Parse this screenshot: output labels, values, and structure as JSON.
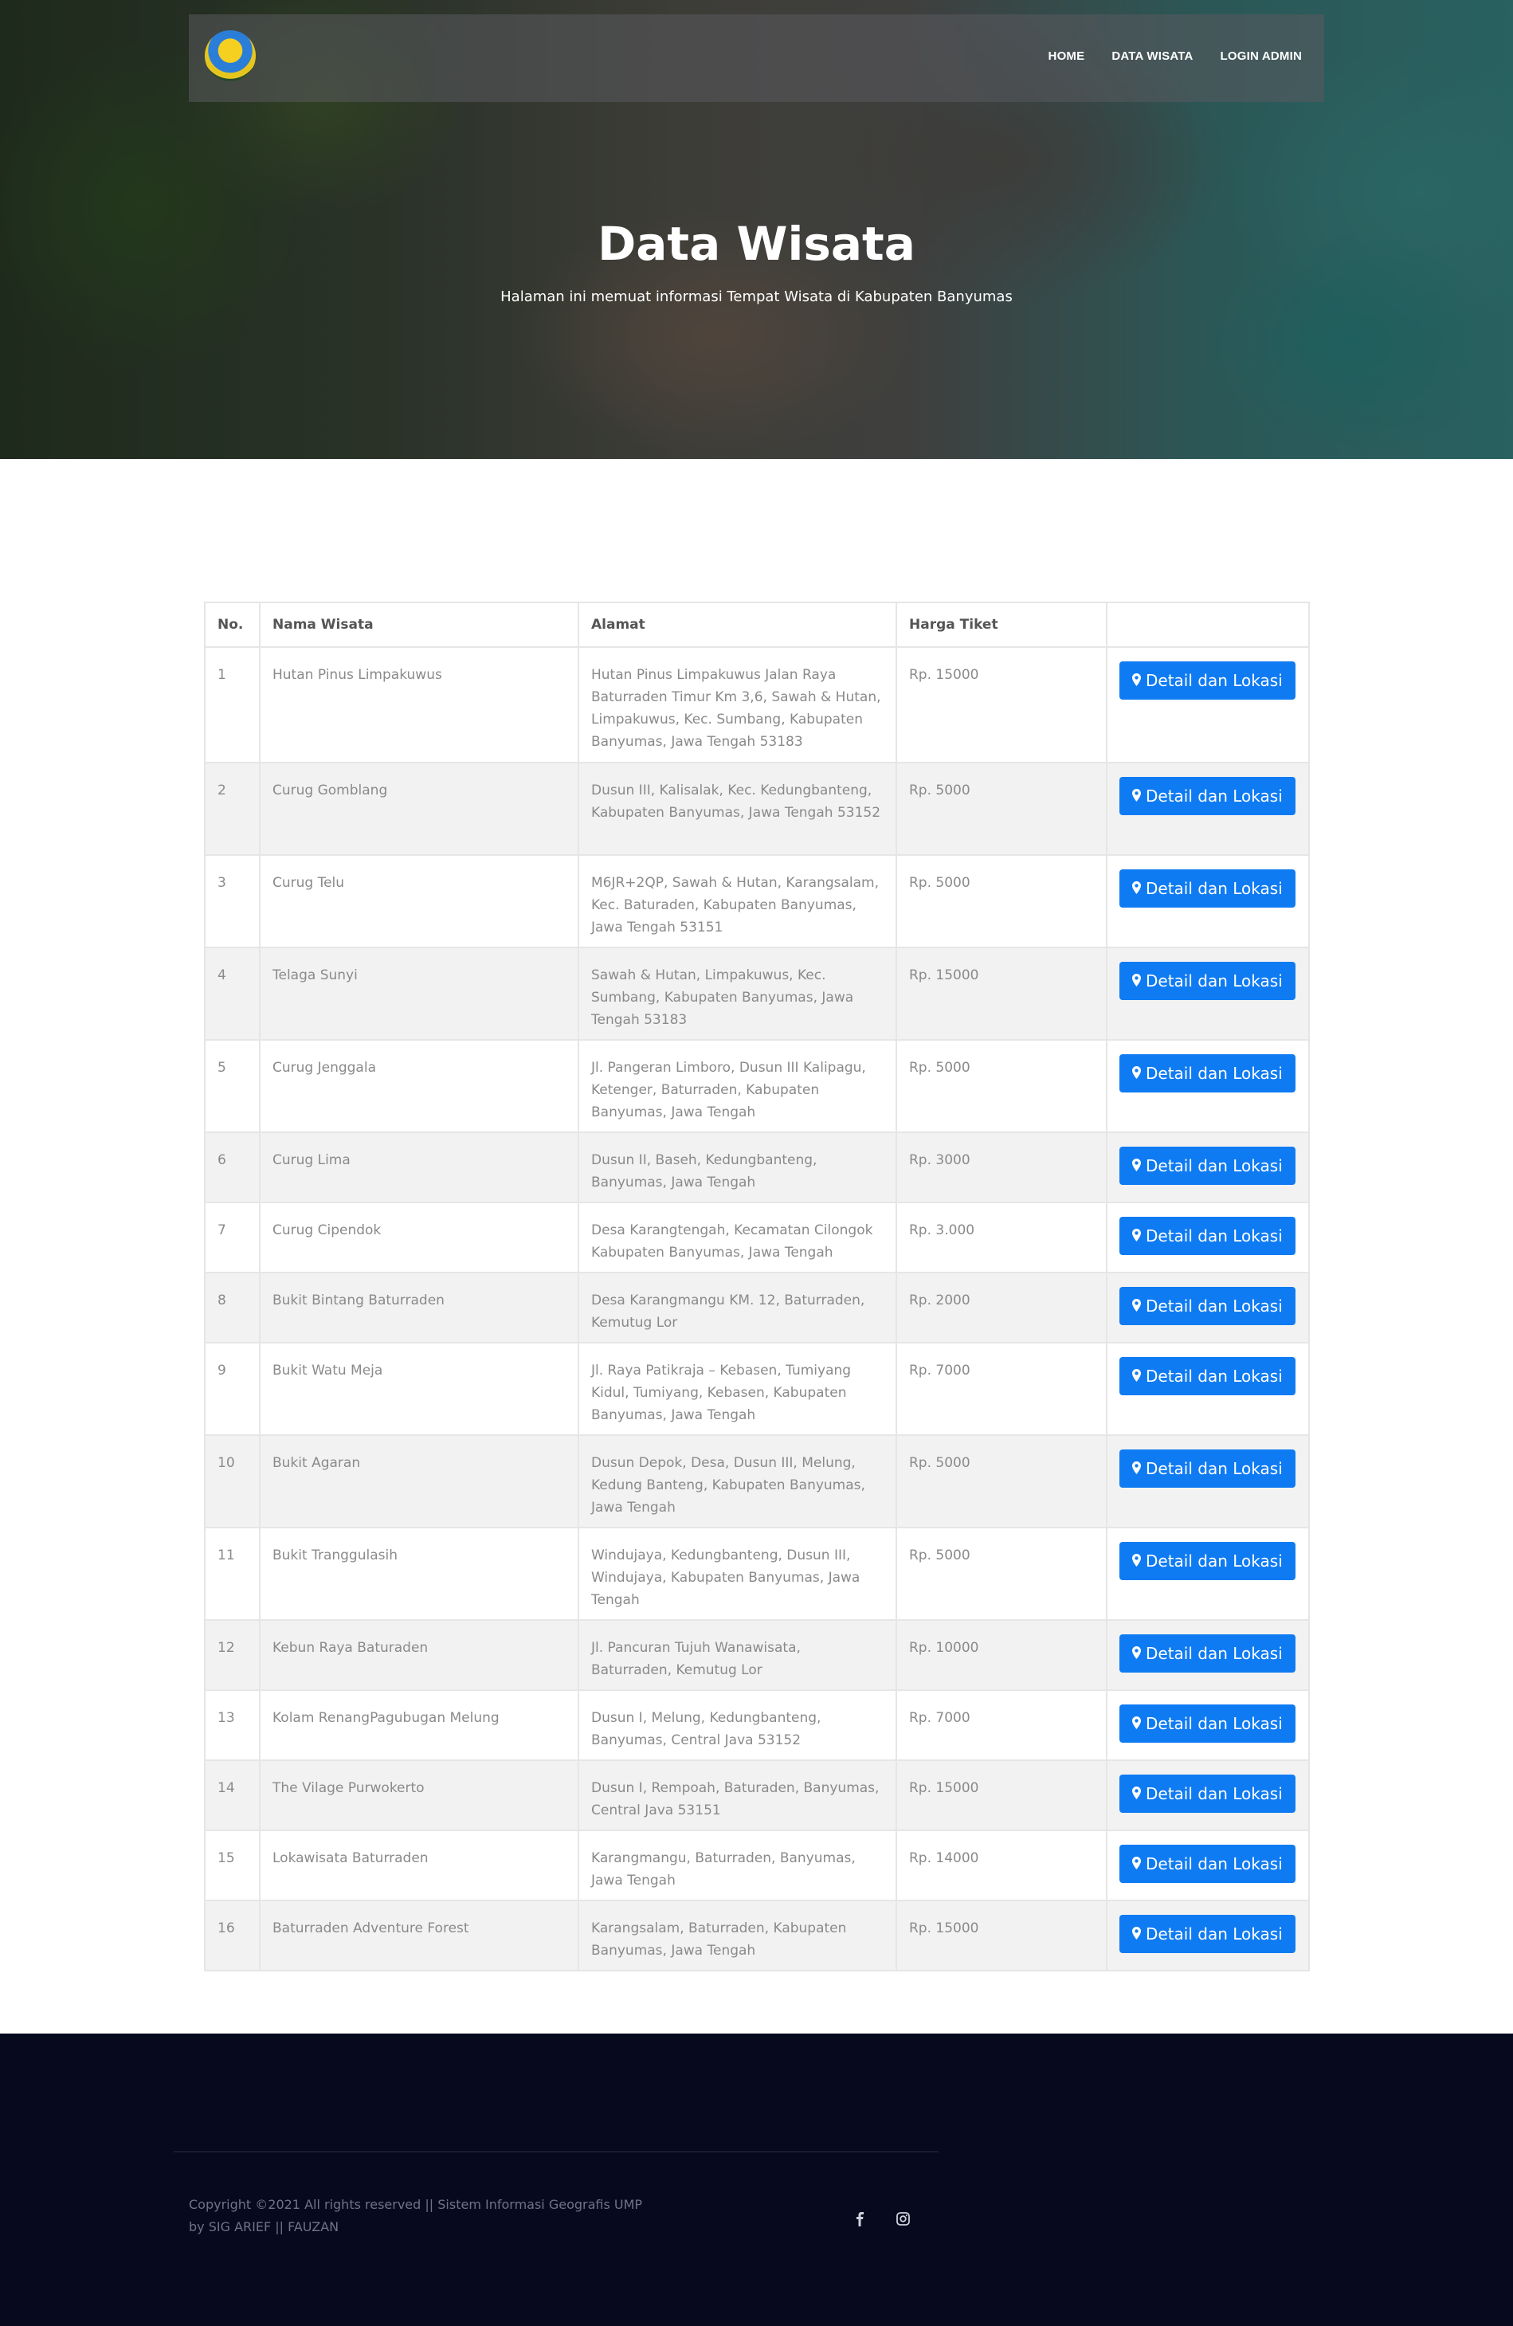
{
  "nav": {
    "links": [
      "HOME",
      "DATA WISATA",
      "LOGIN ADMIN"
    ]
  },
  "hero": {
    "title": "Data Wisata",
    "subtitle": "Halaman ini memuat informasi Tempat Wisata di Kabupaten Banyumas"
  },
  "table": {
    "headers": [
      "No.",
      "Nama Wisata",
      "Alamat",
      "Harga Tiket",
      ""
    ],
    "button_label": "Detail dan Lokasi",
    "rows": [
      {
        "no": "1",
        "nama": "Hutan Pinus Limpakuwus",
        "alamat": "Hutan Pinus Limpakuwus Jalan Raya Baturraden Timur Km 3,6, Sawah & Hutan, Limpakuwus, Kec. Sumbang, Kabupaten Banyumas, Jawa Tengah 53183",
        "harga": "Rp. 15000"
      },
      {
        "no": "2",
        "nama": "Curug Gomblang",
        "alamat": "Dusun III, Kalisalak, Kec. Kedungbanteng, Kabupaten Banyumas, Jawa Tengah 53152",
        "harga": "Rp. 5000"
      },
      {
        "no": "3",
        "nama": "Curug Telu",
        "alamat": "M6JR+2QP, Sawah & Hutan, Karangsalam, Kec. Baturaden, Kabupaten Banyumas, Jawa Tengah 53151",
        "harga": "Rp. 5000"
      },
      {
        "no": "4",
        "nama": "Telaga Sunyi",
        "alamat": "Sawah & Hutan, Limpakuwus, Kec. Sumbang, Kabupaten Banyumas, Jawa Tengah 53183",
        "harga": "Rp. 15000"
      },
      {
        "no": "5",
        "nama": "Curug Jenggala",
        "alamat": "Jl. Pangeran Limboro, Dusun III Kalipagu, Ketenger, Baturraden, Kabupaten Banyumas, Jawa Tengah",
        "harga": "Rp. 5000"
      },
      {
        "no": "6",
        "nama": "Curug Lima",
        "alamat": "Dusun II, Baseh, Kedungbanteng, Banyumas, Jawa Tengah",
        "harga": "Rp. 3000"
      },
      {
        "no": "7",
        "nama": "Curug Cipendok",
        "alamat": "Desa Karangtengah, Kecamatan Cilongok Kabupaten Banyumas, Jawa Tengah",
        "harga": "Rp. 3.000"
      },
      {
        "no": "8",
        "nama": "Bukit Bintang Baturraden",
        "alamat": "Desa Karangmangu KM. 12, Baturraden, Kemutug Lor",
        "harga": "Rp. 2000"
      },
      {
        "no": "9",
        "nama": "Bukit Watu Meja",
        "alamat": "Jl. Raya Patikraja – Kebasen, Tumiyang Kidul, Tumiyang, Kebasen, Kabupaten Banyumas, Jawa Tengah",
        "harga": "Rp. 7000"
      },
      {
        "no": "10",
        "nama": "Bukit Agaran",
        "alamat": "Dusun Depok, Desa, Dusun III, Melung, Kedung Banteng, Kabupaten Banyumas, Jawa Tengah",
        "harga": "Rp. 5000"
      },
      {
        "no": "11",
        "nama": "Bukit Tranggulasih",
        "alamat": "Windujaya, Kedungbanteng, Dusun III, Windujaya, Kabupaten Banyumas, Jawa Tengah",
        "harga": "Rp. 5000"
      },
      {
        "no": "12",
        "nama": "Kebun Raya Baturaden",
        "alamat": "Jl. Pancuran Tujuh Wanawisata, Baturraden, Kemutug Lor",
        "harga": "Rp. 10000"
      },
      {
        "no": "13",
        "nama": "Kolam RenangPagubugan Melung",
        "alamat": "Dusun I, Melung, Kedungbanteng, Banyumas, Central Java 53152",
        "harga": "Rp. 7000"
      },
      {
        "no": "14",
        "nama": "The Vilage Purwokerto",
        "alamat": "Dusun I, Rempoah, Baturaden, Banyumas, Central Java 53151",
        "harga": "Rp. 15000"
      },
      {
        "no": "15",
        "nama": "Lokawisata Baturraden",
        "alamat": "Karangmangu, Baturraden, Banyumas, Jawa Tengah",
        "harga": "Rp. 14000"
      },
      {
        "no": "16",
        "nama": "Baturraden Adventure Forest",
        "alamat": "Karangsalam, Baturraden, Kabupaten Banyumas, Jawa Tengah",
        "harga": "Rp. 15000"
      }
    ]
  },
  "footer": {
    "copyright_line1": "Copyright ©2021 All rights reserved || Sistem Informasi Geografis UMP",
    "copyright_line2": "by SIG ARIEF || FAUZAN",
    "social_icons": [
      "facebook-icon",
      "instagram-icon"
    ]
  }
}
